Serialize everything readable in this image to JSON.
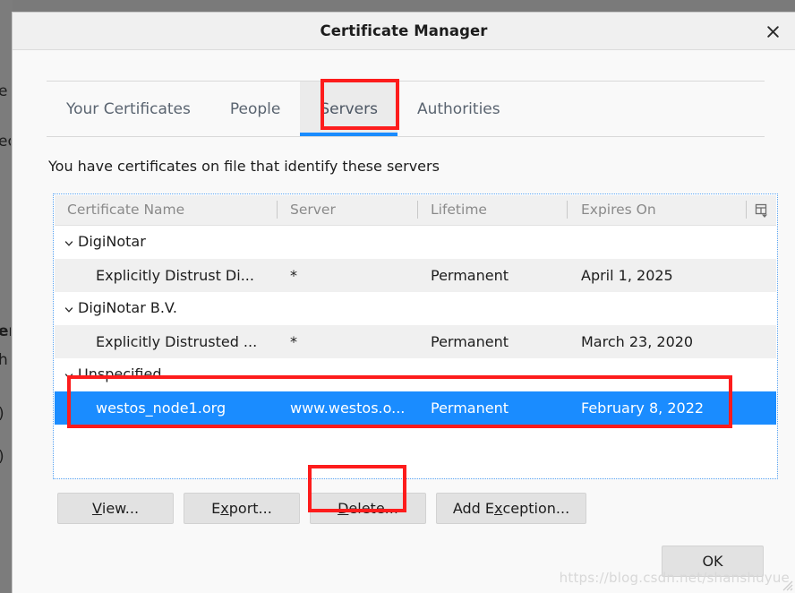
{
  "background_window": {
    "fragments": [
      "e",
      "ec",
      "er",
      "h",
      ")",
      ")"
    ]
  },
  "dialog": {
    "title": "Certificate Manager",
    "close_icon": "close-icon",
    "description": "You have certificates on file that identify these servers"
  },
  "tabs": [
    {
      "label": "Your Certificates",
      "selected": false
    },
    {
      "label": "People",
      "selected": false
    },
    {
      "label": "Servers",
      "selected": true
    },
    {
      "label": "Authorities",
      "selected": false
    }
  ],
  "list": {
    "columns": [
      {
        "label": "Certificate Name"
      },
      {
        "label": "Server"
      },
      {
        "label": "Lifetime"
      },
      {
        "label": "Expires On"
      }
    ],
    "column_picker_icon": "column-picker-icon",
    "rows": [
      {
        "kind": "group",
        "expanded": true,
        "name": "DigiNotar",
        "server": "",
        "lifetime": "",
        "expires_on": ""
      },
      {
        "kind": "cert",
        "name": "Explicitly Distrust Di...",
        "server": "*",
        "lifetime": "Permanent",
        "expires_on": "April 1, 2025"
      },
      {
        "kind": "group",
        "expanded": true,
        "name": "DigiNotar B.V.",
        "server": "",
        "lifetime": "",
        "expires_on": ""
      },
      {
        "kind": "cert",
        "name": "Explicitly Distrusted ...",
        "server": "*",
        "lifetime": "Permanent",
        "expires_on": "March 23, 2020"
      },
      {
        "kind": "group",
        "expanded": true,
        "name": "Unspecified",
        "server": "",
        "lifetime": "",
        "expires_on": ""
      },
      {
        "kind": "cert",
        "selected": true,
        "name": "westos_node1.org",
        "server": "www.westos.o...",
        "lifetime": "Permanent",
        "expires_on": "February 8, 2022"
      }
    ]
  },
  "buttons": {
    "view": {
      "before": "",
      "accel": "V",
      "after": "iew..."
    },
    "export": {
      "before": "E",
      "accel": "x",
      "after": "port..."
    },
    "delete": {
      "before": "",
      "accel": "D",
      "after": "elete..."
    },
    "add_exception": {
      "before": "Add E",
      "accel": "x",
      "after": "ception..."
    },
    "ok": "OK"
  },
  "watermark": "https://blog.csdn.net/shanshuyue",
  "colors": {
    "selection_blue": "#1a8cff",
    "tab_underline": "#1a8cff",
    "annotation_red": "#fd1c1c",
    "dialog_bg": "#f9f9f9",
    "titlebar_bg": "#f0f0f0",
    "button_bg": "#e2e2e2",
    "row_alt_bg": "#f0f0f0"
  }
}
